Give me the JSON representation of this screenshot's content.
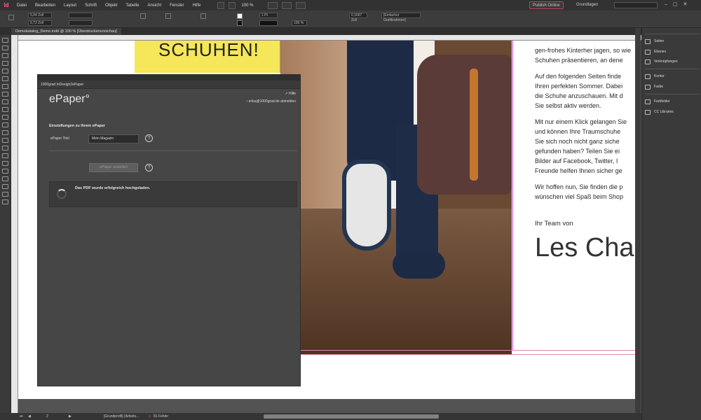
{
  "app": {
    "logo": "Id"
  },
  "menu": [
    "Datei",
    "Bearbeiten",
    "Layout",
    "Schrift",
    "Objekt",
    "Tabelle",
    "Ansicht",
    "Fenster",
    "Hilfe"
  ],
  "zoom": "100 %",
  "publish_label": "Publish Online",
  "workspace": "Grundlagen",
  "control": {
    "x": "5,04 Zoll",
    "y": "9,72 Zoll",
    "stroke_weight": "1 Pt",
    "zoom_pct": "100 %",
    "size_field": "0,1667 Zoll",
    "frame_style": "[Einfacher Grafikrahmen]"
  },
  "tab": "Demokatalog_Demo.indd @ 100 % [Überdruckenvorschau]",
  "page": {
    "yellow_heading": "SCHUHEN!",
    "copy": [
      [
        "gen-frohes Kinterher jagen, so wie",
        "Schuhen präsentieren, an dene"
      ],
      [
        "Auf den folgenden Seiten finde",
        "Ihren perfekten Sommer. Dabei",
        "die Schuhe anzuschauen. Mit d",
        "Sie selbst aktiv werden."
      ],
      [
        "Mit nur einem Klick gelangen Sie",
        "und können Ihre Traumschuhe",
        "Sie sich noch nicht ganz siche",
        "gefunden haben? Teilen Sie ei",
        "Bilder auf Facebook, Twitter, I",
        "Freunde helfen Ihnen sicher ge"
      ],
      [
        "Wir hoffen nun, Sie finden die p",
        "wünschen viel Spaß beim Shop"
      ]
    ],
    "team": "Ihr Team von",
    "signature": "Les Chau"
  },
  "right_panel": [
    {
      "icon": "pages-icon",
      "label": "Seiten"
    },
    {
      "icon": "layers-icon",
      "label": "Ebenen"
    },
    {
      "icon": "links-icon",
      "label": "Verknüpfungen"
    },
    {
      "icon": "stroke-icon",
      "label": "Kontur"
    },
    {
      "icon": "color-icon",
      "label": "Farbe"
    },
    {
      "icon": "swatches-icon",
      "label": "Farbfelder"
    },
    {
      "icon": "cc-libraries-icon",
      "label": "CC Libraries"
    }
  ],
  "status": {
    "page": "2",
    "profile": "[Grundprofil] (Arbeits...",
    "errors": "81 Fehler"
  },
  "dialog": {
    "title": "1000grad InDesign2ePaper",
    "logo": "ePaper°",
    "help": "Hilfe",
    "logout": "erika@1000grad.de abmelden",
    "section": "Einstellungen zu Ihrem ePaper",
    "title_label": "ePaper Titel",
    "title_value": "Mein Magazin",
    "create_btn": "ePaper erstellen",
    "status_msg": "Das PDF wurde erfolgreich hochgeladen.",
    "help_glyph": "?"
  }
}
